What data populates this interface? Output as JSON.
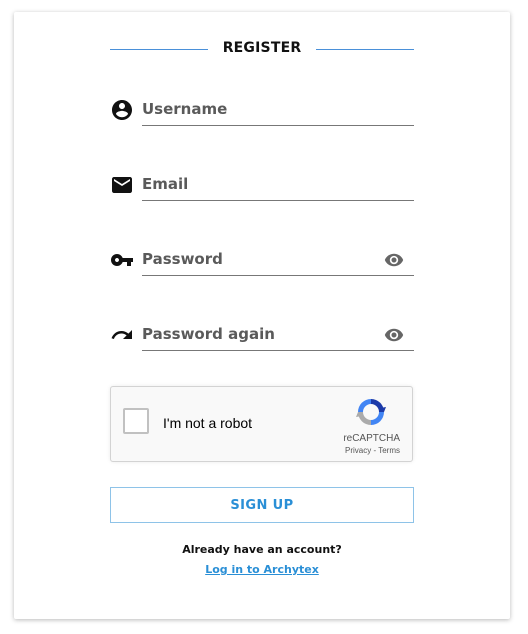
{
  "form": {
    "title": "REGISTER",
    "fields": [
      {
        "placeholder": "Username",
        "icon": "account-circle-icon"
      },
      {
        "placeholder": "Email",
        "icon": "mail-icon"
      },
      {
        "placeholder": "Password",
        "icon": "key-icon",
        "toggle_icon": "eye-icon"
      },
      {
        "placeholder": "Password again",
        "icon": "redo-arrow-icon",
        "toggle_icon": "eye-icon"
      }
    ],
    "captcha": {
      "label": "I'm not a robot",
      "brand": "reCAPTCHA",
      "privacy": "Privacy",
      "separator": " - ",
      "terms": "Terms"
    },
    "signup_label": "SIGN UP",
    "already_text": "Already have an account?",
    "login_link": "Log in to Archytex"
  },
  "colors": {
    "accent": "#2a8fd6",
    "title_lines": "#4a90d9",
    "icon": "#111111",
    "eye": "#666666"
  }
}
